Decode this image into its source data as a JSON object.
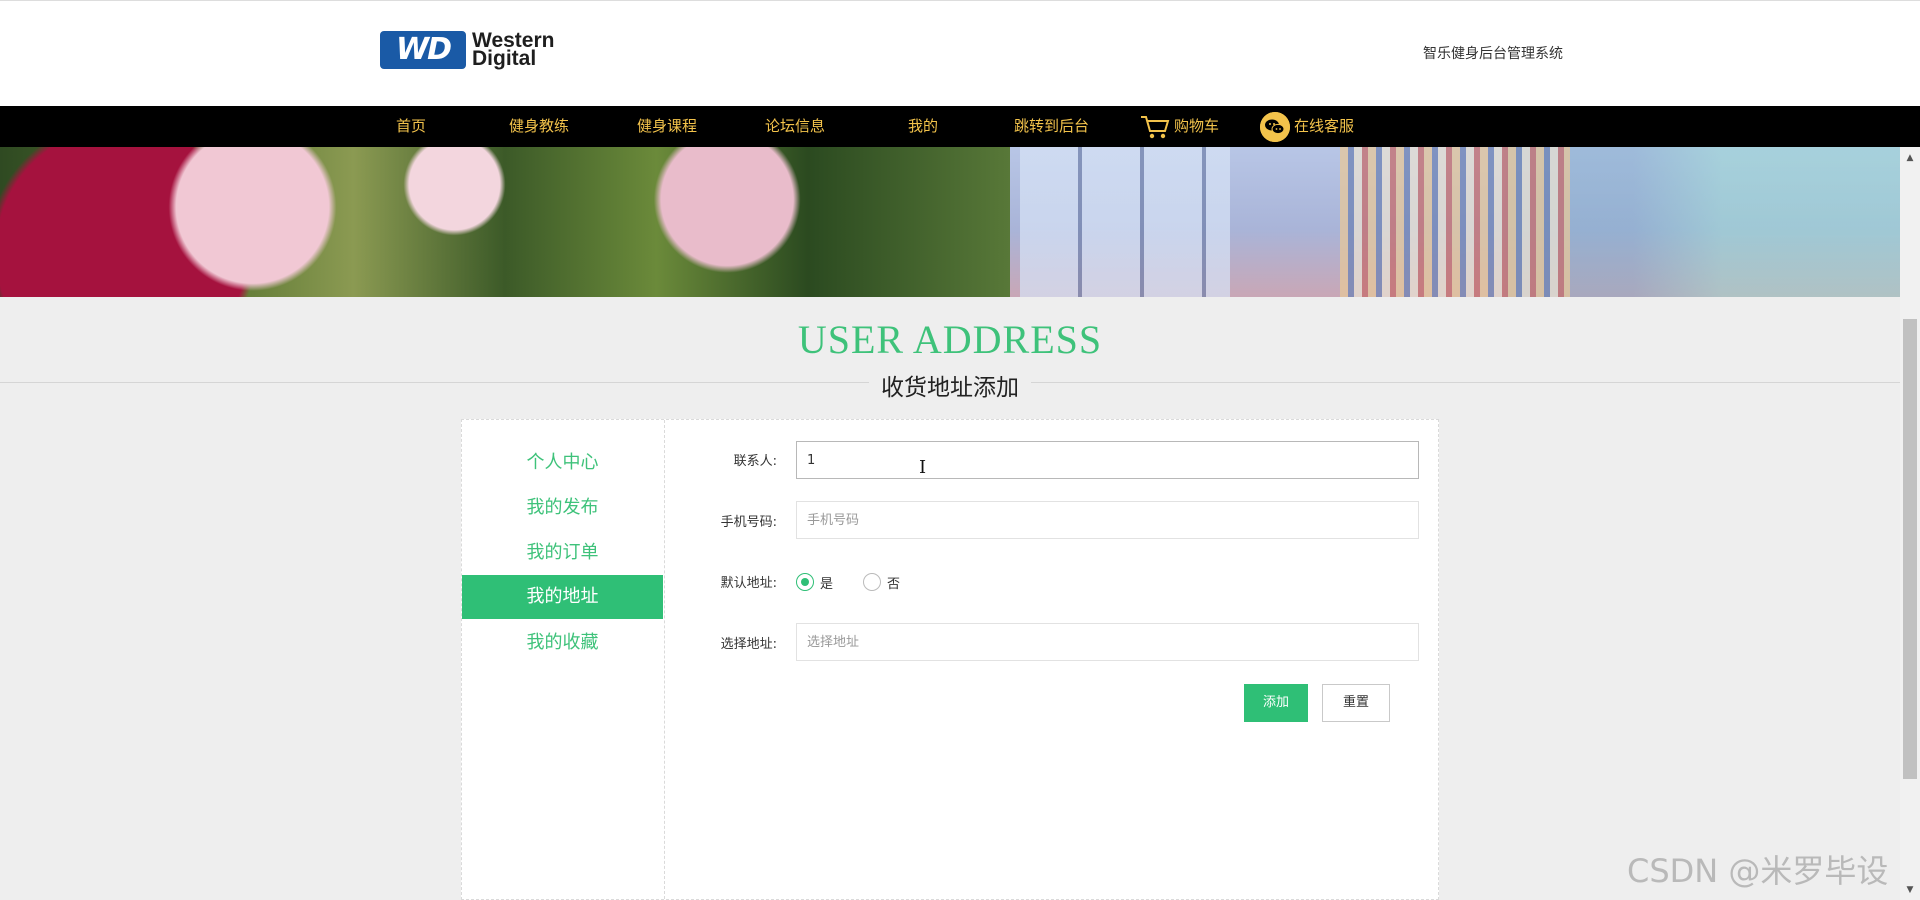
{
  "header": {
    "logo_mark": "WD",
    "logo_line1": "Western",
    "logo_line2": "Digital",
    "system_name": "智乐健身后台管理系统"
  },
  "nav": {
    "items": [
      {
        "label": "首页"
      },
      {
        "label": "健身教练"
      },
      {
        "label": "健身课程"
      },
      {
        "label": "论坛信息"
      },
      {
        "label": "我的"
      },
      {
        "label": "跳转到后台"
      },
      {
        "label": "购物车",
        "icon": "cart-icon"
      },
      {
        "label": "在线客服",
        "icon": "wechat-icon"
      }
    ]
  },
  "page": {
    "title_en": "USER ADDRESS",
    "title_cn": "收货地址添加"
  },
  "sidebar": {
    "items": [
      {
        "label": "个人中心"
      },
      {
        "label": "我的发布"
      },
      {
        "label": "我的订单"
      },
      {
        "label": "我的地址",
        "active": true
      },
      {
        "label": "我的收藏"
      }
    ]
  },
  "form": {
    "contact": {
      "label": "联系人:",
      "value": "1"
    },
    "phone": {
      "label": "手机号码:",
      "placeholder": "手机号码",
      "value": ""
    },
    "default_address": {
      "label": "默认地址:",
      "options": [
        "是",
        "否"
      ],
      "selected": "是"
    },
    "address": {
      "label": "选择地址:",
      "placeholder": "选择地址",
      "value": ""
    },
    "add_button": "添加",
    "reset_button": "重置"
  },
  "overlay": {
    "watermark": "CSDN @米罗毕设"
  },
  "colors": {
    "accent": "#2fbf76",
    "nav_text": "#f3c34b",
    "nav_bg": "#000000"
  }
}
